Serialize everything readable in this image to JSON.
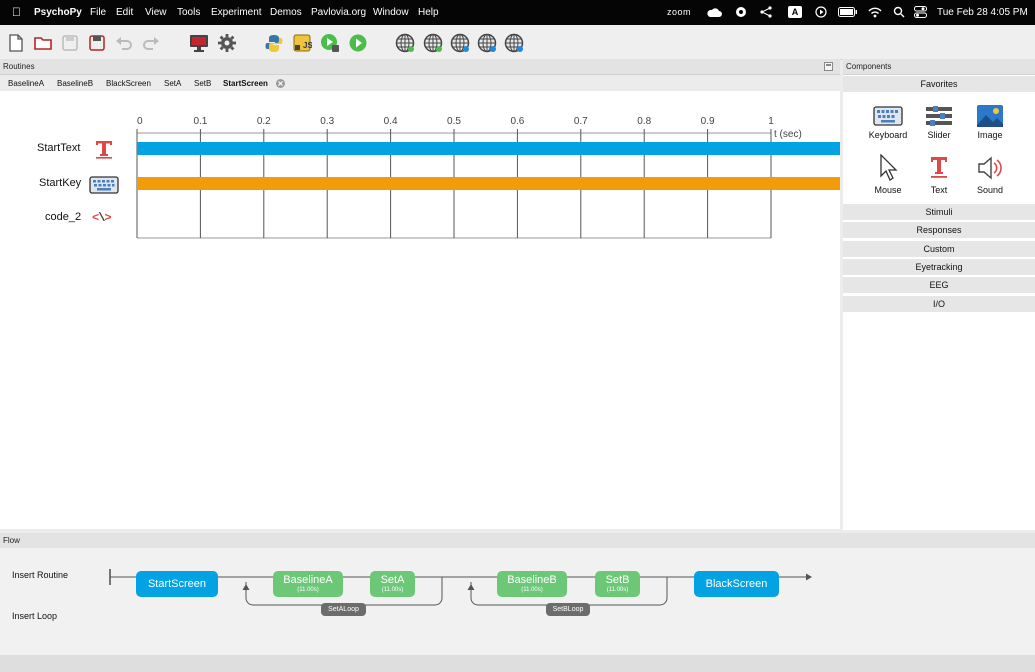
{
  "menubar": {
    "app_name": "PsychoPy",
    "menus": [
      "File",
      "Edit",
      "View",
      "Tools",
      "Experiment",
      "Demos",
      "Pavlovia.org",
      "Window",
      "Help"
    ],
    "zoom_label": "zoom",
    "input_source": "A",
    "datetime": "Tue Feb 28  4:05 PM"
  },
  "panes": {
    "routines_label": "Routines",
    "components_label": "Components",
    "flow_label": "Flow"
  },
  "tabs": [
    "BaselineA",
    "BaselineB",
    "BlackScreen",
    "SetA",
    "SetB",
    "StartScreen"
  ],
  "active_tab": "StartScreen",
  "timeline": {
    "ticks": [
      "0",
      "0.1",
      "0.2",
      "0.3",
      "0.4",
      "0.5",
      "0.6",
      "0.7",
      "0.8",
      "0.9",
      "1"
    ],
    "axis_unit": "t (sec)",
    "components": [
      {
        "name": "StartText",
        "icon": "text-icon",
        "bar_color": "#02a2e3"
      },
      {
        "name": "StartKey",
        "icon": "keyboard-icon",
        "bar_color": "#f39c0a"
      },
      {
        "name": "code_2",
        "icon": "code-icon",
        "bar_color": ""
      }
    ]
  },
  "components_panel": {
    "favorites_label": "Favorites",
    "favorites": [
      "Keyboard",
      "Slider",
      "Image",
      "Mouse",
      "Text",
      "Sound"
    ],
    "categories": [
      "Stimuli",
      "Responses",
      "Custom",
      "Eyetracking",
      "EEG",
      "I/O"
    ]
  },
  "flow": {
    "insert_routine_label": "Insert Routine",
    "insert_loop_label": "Insert Loop",
    "routines": [
      {
        "name": "StartScreen",
        "duration": "",
        "color": "#02a2e3"
      },
      {
        "name": "BaselineA",
        "duration": "(11.00s)",
        "color": "#6cc877"
      },
      {
        "name": "SetA",
        "duration": "(11.00s)",
        "color": "#6cc877"
      },
      {
        "name": "BaselineB",
        "duration": "(11.00s)",
        "color": "#6cc877"
      },
      {
        "name": "SetB",
        "duration": "(11.00s)",
        "color": "#6cc877"
      },
      {
        "name": "BlackScreen",
        "duration": "",
        "color": "#02a2e3"
      }
    ],
    "loops": [
      {
        "name": "SetALoop"
      },
      {
        "name": "SetBLoop"
      }
    ]
  }
}
